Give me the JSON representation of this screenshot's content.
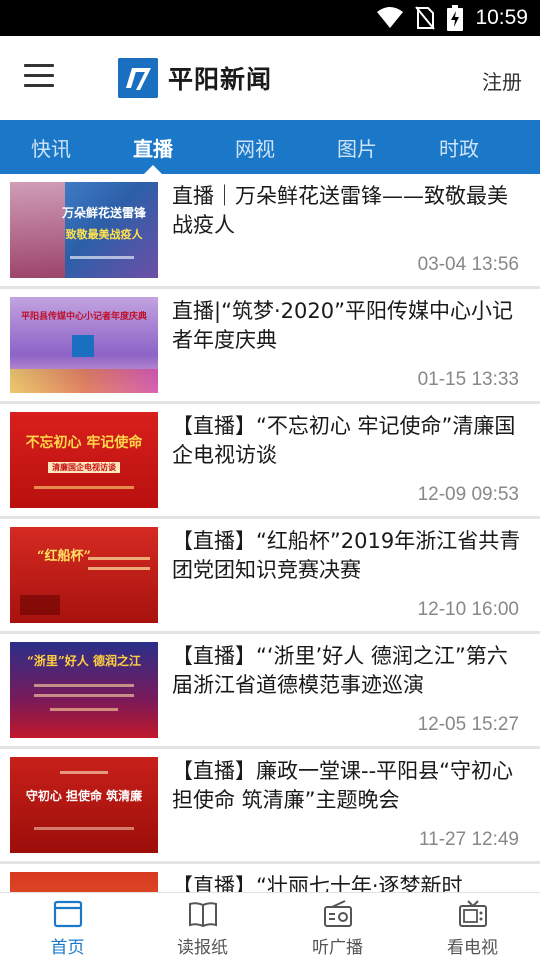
{
  "status_bar": {
    "time": "10:59"
  },
  "header": {
    "app_title": "平阳新闻",
    "register_label": "注册"
  },
  "tabs": [
    {
      "label": "快讯",
      "active": false
    },
    {
      "label": "直播",
      "active": true
    },
    {
      "label": "网视",
      "active": false
    },
    {
      "label": "图片",
      "active": false
    },
    {
      "label": "时政",
      "active": false
    }
  ],
  "news": [
    {
      "title": "直播｜万朵鲜花送雷锋——致敬最美战疫人",
      "date": "03-04 13:56",
      "thumb_text": "万朵鲜花送雷锋",
      "thumb_sub": "致敬最美战疫人"
    },
    {
      "title": "直播|“筑梦·2020”平阳传媒中心小记者年度庆典",
      "date": "01-15 13:33",
      "thumb_text": "平阳县传媒中心小记者年度庆典",
      "thumb_sub": ""
    },
    {
      "title": "【直播】“不忘初心 牢记使命”清廉国企电视访谈",
      "date": "12-09 09:53",
      "thumb_text": "不忘初心 牢记使命",
      "thumb_sub": "清廉国企电视访谈"
    },
    {
      "title": "【直播】“红船杯”2019年浙江省共青团党团知识竞赛决赛",
      "date": "12-10 16:00",
      "thumb_text": "“红船杯”",
      "thumb_sub": ""
    },
    {
      "title": "【直播】“‘浙里’好人 德润之江”第六届浙江省道德模范事迹巡演",
      "date": "12-05 15:27",
      "thumb_text": "“浙里”好人 德润之江",
      "thumb_sub": ""
    },
    {
      "title": "【直播】廉政一堂课--平阳县“守初心 担使命 筑清廉”主题晚会",
      "date": "11-27 12:49",
      "thumb_text": "守初心 担使命 筑清廉",
      "thumb_sub": ""
    },
    {
      "title": "【直播】“壮丽七十年·逐梦新时",
      "date": "",
      "thumb_text": "",
      "thumb_sub": ""
    }
  ],
  "bottom_nav": [
    {
      "label": "首页",
      "icon": "home-icon",
      "active": true
    },
    {
      "label": "读报纸",
      "icon": "book-icon",
      "active": false
    },
    {
      "label": "听广播",
      "icon": "radio-icon",
      "active": false
    },
    {
      "label": "看电视",
      "icon": "tv-icon",
      "active": false
    }
  ],
  "colors": {
    "accent": "#1b78c8",
    "tab_bar": "#1b78c8",
    "date_text": "#888888"
  }
}
